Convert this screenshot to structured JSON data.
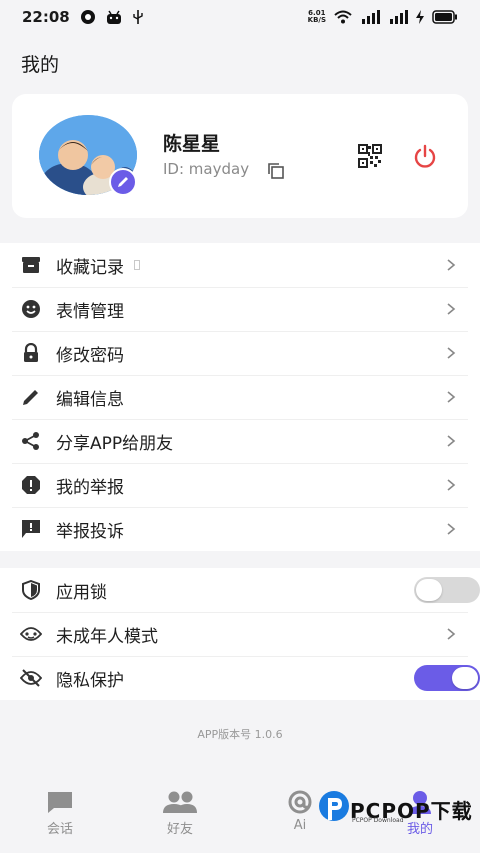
{
  "status": {
    "time": "22:08",
    "netspeed_value": "6.01",
    "netspeed_unit": "KB/S"
  },
  "header": {
    "title": "我的"
  },
  "profile": {
    "name": "陈星星",
    "id_text": "ID: mayday"
  },
  "menu_group1": [
    {
      "label": "收藏记录",
      "icon": "archive-icon"
    },
    {
      "label": "表情管理",
      "icon": "smiley-icon"
    },
    {
      "label": "修改密码",
      "icon": "lock-icon"
    },
    {
      "label": "编辑信息",
      "icon": "pencil-icon"
    },
    {
      "label": "分享APP给朋友",
      "icon": "share-icon"
    },
    {
      "label": "我的举报",
      "icon": "alert-icon"
    },
    {
      "label": "举报投诉",
      "icon": "report-icon"
    }
  ],
  "menu_group2": [
    {
      "label": "应用锁",
      "icon": "shield-icon",
      "toggle": false
    },
    {
      "label": "未成年人模式",
      "icon": "eye-icon"
    },
    {
      "label": "隐私保护",
      "icon": "eye-off-icon",
      "toggle": true
    }
  ],
  "version_text": "APP版本号 1.0.6",
  "tabs": [
    {
      "label": "会话",
      "icon": "chat-icon"
    },
    {
      "label": "好友",
      "icon": "friends-icon"
    },
    {
      "label": "Ai",
      "icon": "at-icon"
    },
    {
      "label": "我的",
      "icon": "profile-icon",
      "active": true
    }
  ],
  "watermark": {
    "text": "PCPOP下载",
    "sub": "PCPOP Download"
  },
  "colors": {
    "accent": "#6b5ce7",
    "danger": "#e64545",
    "background": "#f4f4f6"
  }
}
